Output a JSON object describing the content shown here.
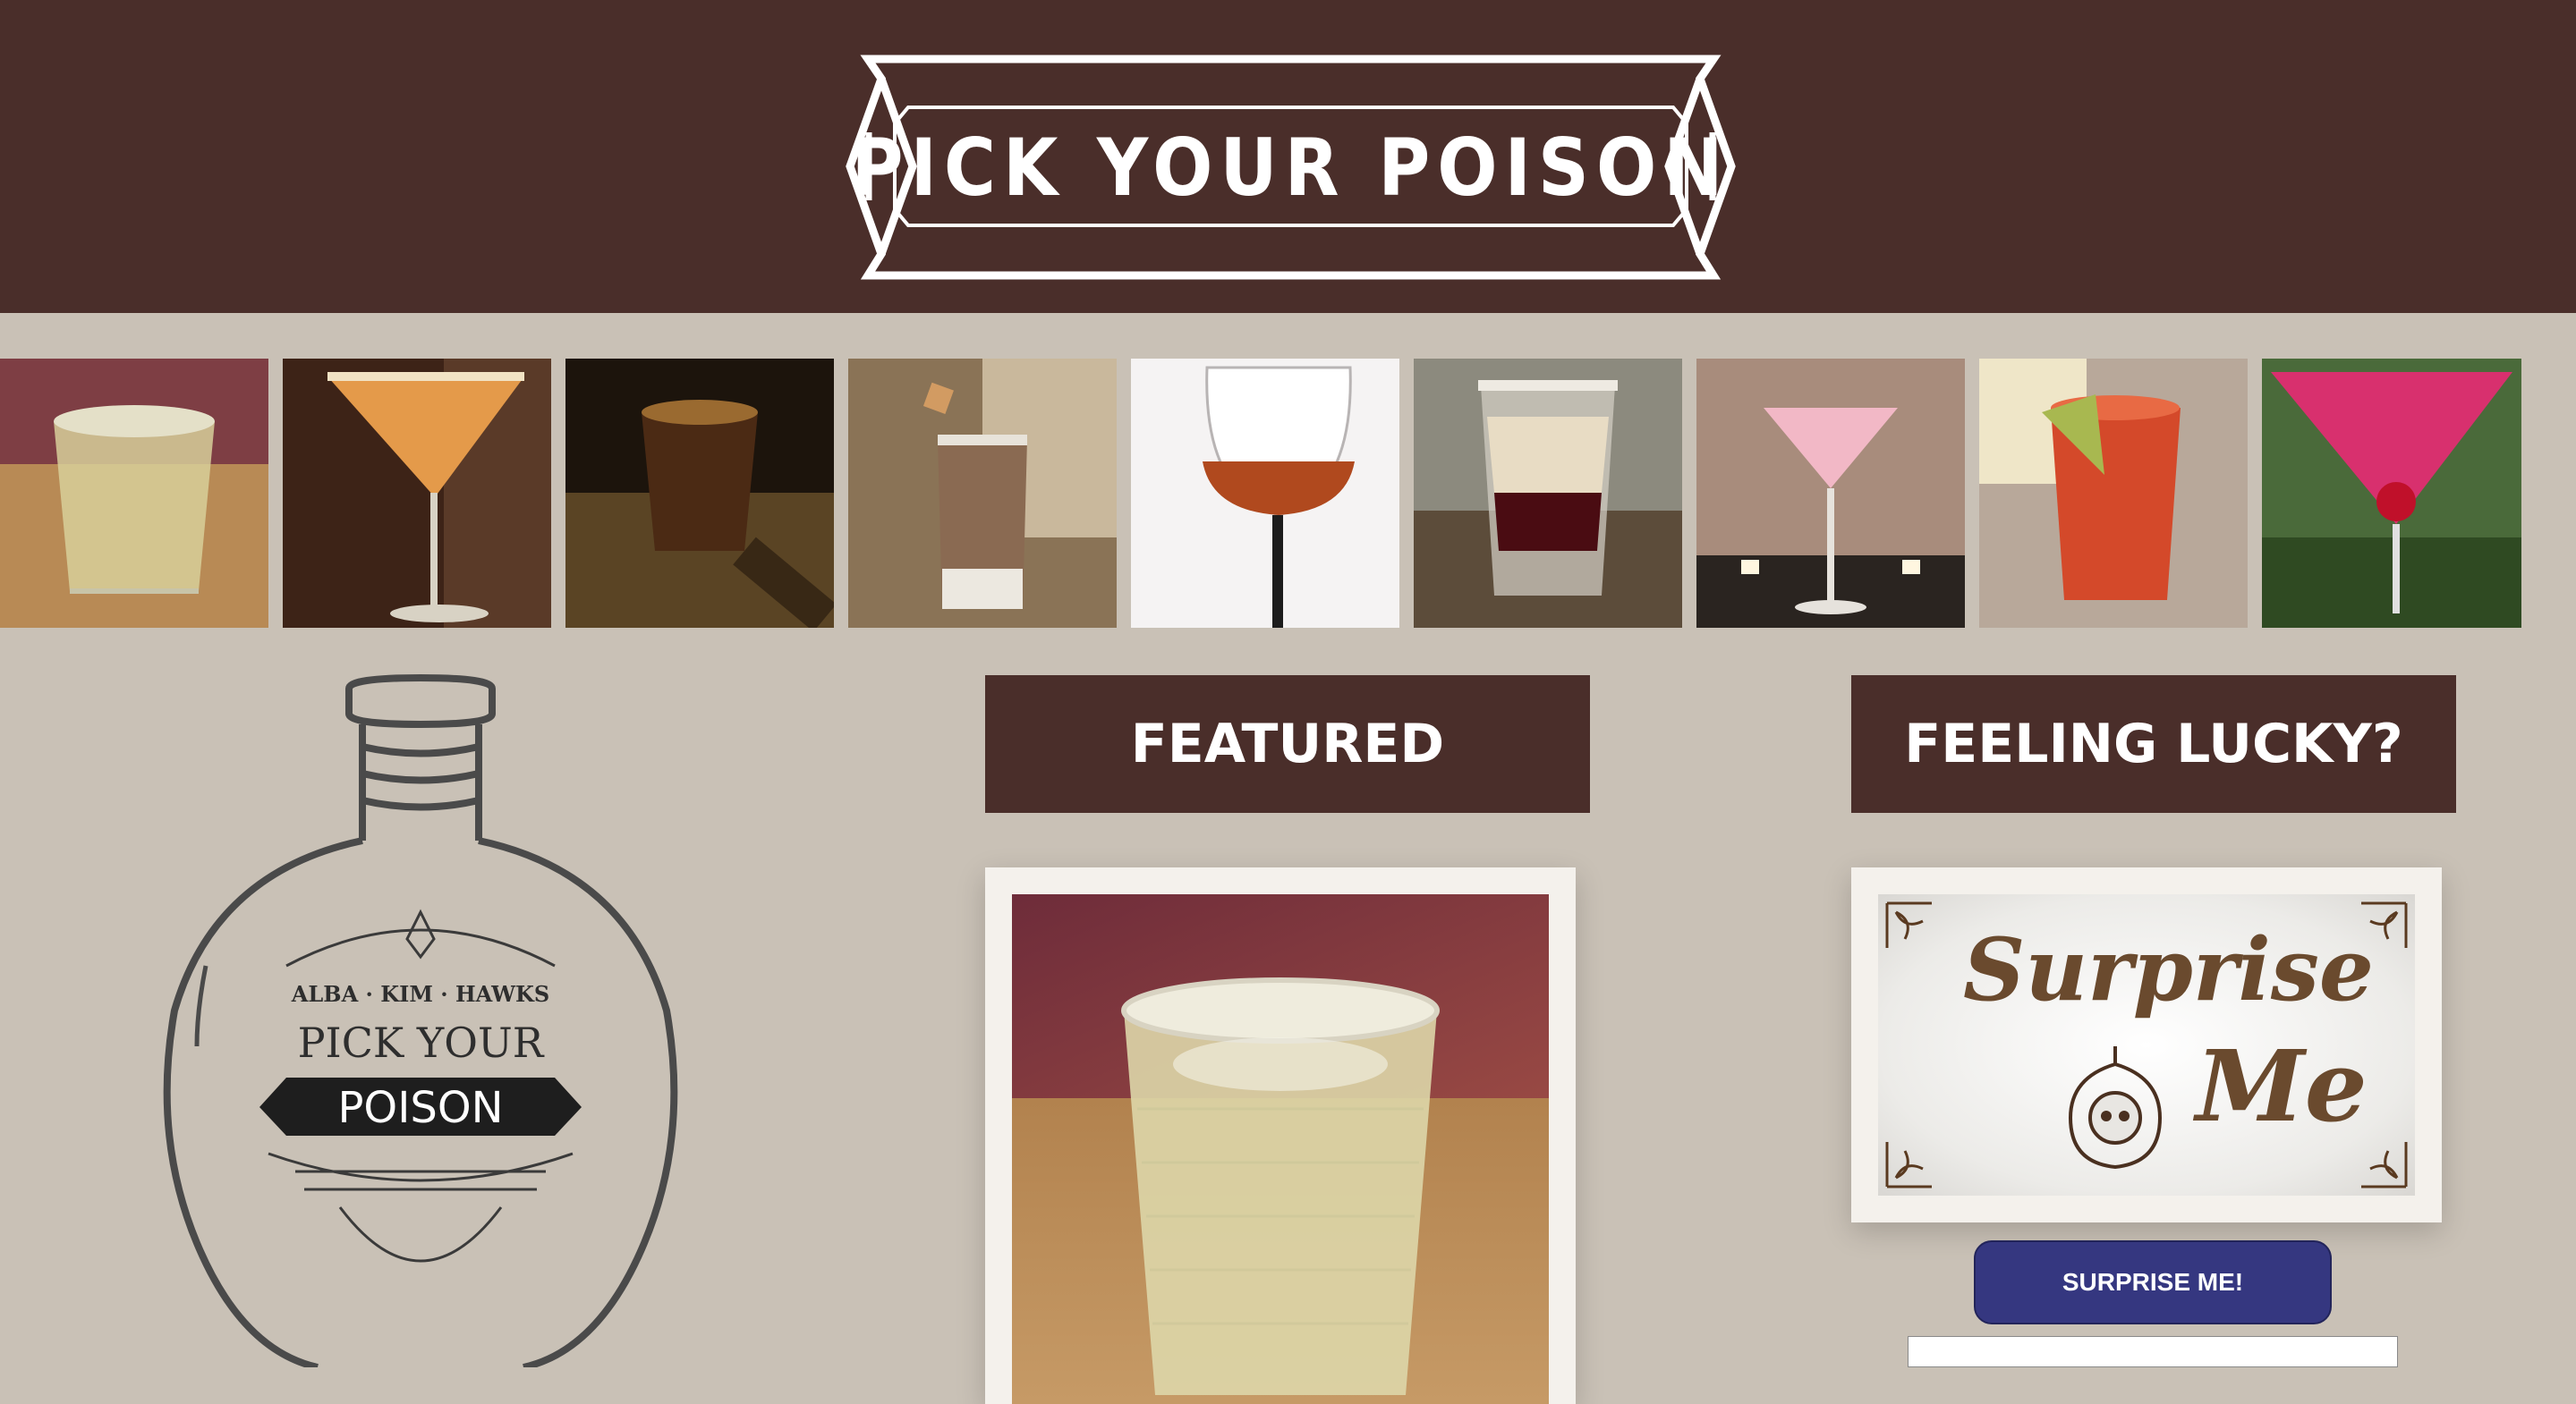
{
  "header": {
    "title": "PICK YOUR POISON"
  },
  "gallery": {
    "items": [
      {
        "name": "whiskey-tumbler"
      },
      {
        "name": "orange-martini"
      },
      {
        "name": "dark-shot"
      },
      {
        "name": "cream-shot"
      },
      {
        "name": "red-wine"
      },
      {
        "name": "layered-shot"
      },
      {
        "name": "pink-martini"
      },
      {
        "name": "red-highball"
      },
      {
        "name": "cherry-martini"
      }
    ]
  },
  "logo": {
    "names": "ALBA · KIM · HAWKS",
    "line1": "PICK  YOUR",
    "line2": "POISON"
  },
  "featured": {
    "heading": "FEATURED"
  },
  "lucky": {
    "heading": "FEELING LUCKY?",
    "card_word1": "Surprise",
    "card_word2": "Me",
    "button_label": "SURPRISE ME!"
  },
  "colors": {
    "header_bg": "#4a2e2a",
    "page_bg": "#c9c1b6",
    "button_bg": "#353780"
  }
}
